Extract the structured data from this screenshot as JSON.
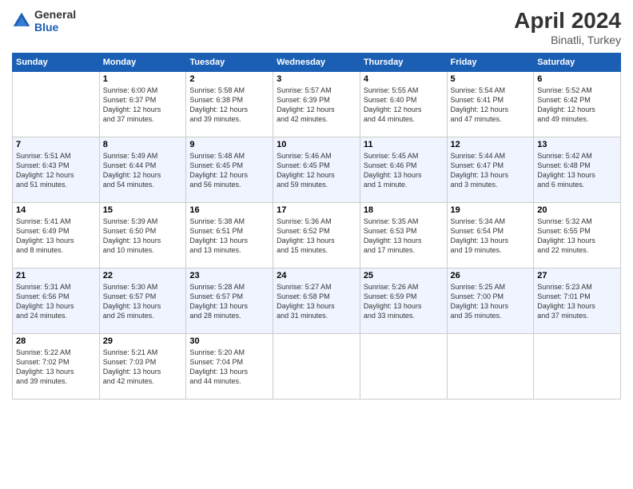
{
  "header": {
    "logo_line1": "General",
    "logo_line2": "Blue",
    "month": "April 2024",
    "location": "Binatli, Turkey"
  },
  "weekdays": [
    "Sunday",
    "Monday",
    "Tuesday",
    "Wednesday",
    "Thursday",
    "Friday",
    "Saturday"
  ],
  "weeks": [
    [
      {
        "day": "",
        "info": ""
      },
      {
        "day": "1",
        "info": "Sunrise: 6:00 AM\nSunset: 6:37 PM\nDaylight: 12 hours\nand 37 minutes."
      },
      {
        "day": "2",
        "info": "Sunrise: 5:58 AM\nSunset: 6:38 PM\nDaylight: 12 hours\nand 39 minutes."
      },
      {
        "day": "3",
        "info": "Sunrise: 5:57 AM\nSunset: 6:39 PM\nDaylight: 12 hours\nand 42 minutes."
      },
      {
        "day": "4",
        "info": "Sunrise: 5:55 AM\nSunset: 6:40 PM\nDaylight: 12 hours\nand 44 minutes."
      },
      {
        "day": "5",
        "info": "Sunrise: 5:54 AM\nSunset: 6:41 PM\nDaylight: 12 hours\nand 47 minutes."
      },
      {
        "day": "6",
        "info": "Sunrise: 5:52 AM\nSunset: 6:42 PM\nDaylight: 12 hours\nand 49 minutes."
      }
    ],
    [
      {
        "day": "7",
        "info": "Sunrise: 5:51 AM\nSunset: 6:43 PM\nDaylight: 12 hours\nand 51 minutes."
      },
      {
        "day": "8",
        "info": "Sunrise: 5:49 AM\nSunset: 6:44 PM\nDaylight: 12 hours\nand 54 minutes."
      },
      {
        "day": "9",
        "info": "Sunrise: 5:48 AM\nSunset: 6:45 PM\nDaylight: 12 hours\nand 56 minutes."
      },
      {
        "day": "10",
        "info": "Sunrise: 5:46 AM\nSunset: 6:45 PM\nDaylight: 12 hours\nand 59 minutes."
      },
      {
        "day": "11",
        "info": "Sunrise: 5:45 AM\nSunset: 6:46 PM\nDaylight: 13 hours\nand 1 minute."
      },
      {
        "day": "12",
        "info": "Sunrise: 5:44 AM\nSunset: 6:47 PM\nDaylight: 13 hours\nand 3 minutes."
      },
      {
        "day": "13",
        "info": "Sunrise: 5:42 AM\nSunset: 6:48 PM\nDaylight: 13 hours\nand 6 minutes."
      }
    ],
    [
      {
        "day": "14",
        "info": "Sunrise: 5:41 AM\nSunset: 6:49 PM\nDaylight: 13 hours\nand 8 minutes."
      },
      {
        "day": "15",
        "info": "Sunrise: 5:39 AM\nSunset: 6:50 PM\nDaylight: 13 hours\nand 10 minutes."
      },
      {
        "day": "16",
        "info": "Sunrise: 5:38 AM\nSunset: 6:51 PM\nDaylight: 13 hours\nand 13 minutes."
      },
      {
        "day": "17",
        "info": "Sunrise: 5:36 AM\nSunset: 6:52 PM\nDaylight: 13 hours\nand 15 minutes."
      },
      {
        "day": "18",
        "info": "Sunrise: 5:35 AM\nSunset: 6:53 PM\nDaylight: 13 hours\nand 17 minutes."
      },
      {
        "day": "19",
        "info": "Sunrise: 5:34 AM\nSunset: 6:54 PM\nDaylight: 13 hours\nand 19 minutes."
      },
      {
        "day": "20",
        "info": "Sunrise: 5:32 AM\nSunset: 6:55 PM\nDaylight: 13 hours\nand 22 minutes."
      }
    ],
    [
      {
        "day": "21",
        "info": "Sunrise: 5:31 AM\nSunset: 6:56 PM\nDaylight: 13 hours\nand 24 minutes."
      },
      {
        "day": "22",
        "info": "Sunrise: 5:30 AM\nSunset: 6:57 PM\nDaylight: 13 hours\nand 26 minutes."
      },
      {
        "day": "23",
        "info": "Sunrise: 5:28 AM\nSunset: 6:57 PM\nDaylight: 13 hours\nand 28 minutes."
      },
      {
        "day": "24",
        "info": "Sunrise: 5:27 AM\nSunset: 6:58 PM\nDaylight: 13 hours\nand 31 minutes."
      },
      {
        "day": "25",
        "info": "Sunrise: 5:26 AM\nSunset: 6:59 PM\nDaylight: 13 hours\nand 33 minutes."
      },
      {
        "day": "26",
        "info": "Sunrise: 5:25 AM\nSunset: 7:00 PM\nDaylight: 13 hours\nand 35 minutes."
      },
      {
        "day": "27",
        "info": "Sunrise: 5:23 AM\nSunset: 7:01 PM\nDaylight: 13 hours\nand 37 minutes."
      }
    ],
    [
      {
        "day": "28",
        "info": "Sunrise: 5:22 AM\nSunset: 7:02 PM\nDaylight: 13 hours\nand 39 minutes."
      },
      {
        "day": "29",
        "info": "Sunrise: 5:21 AM\nSunset: 7:03 PM\nDaylight: 13 hours\nand 42 minutes."
      },
      {
        "day": "30",
        "info": "Sunrise: 5:20 AM\nSunset: 7:04 PM\nDaylight: 13 hours\nand 44 minutes."
      },
      {
        "day": "",
        "info": ""
      },
      {
        "day": "",
        "info": ""
      },
      {
        "day": "",
        "info": ""
      },
      {
        "day": "",
        "info": ""
      }
    ]
  ]
}
